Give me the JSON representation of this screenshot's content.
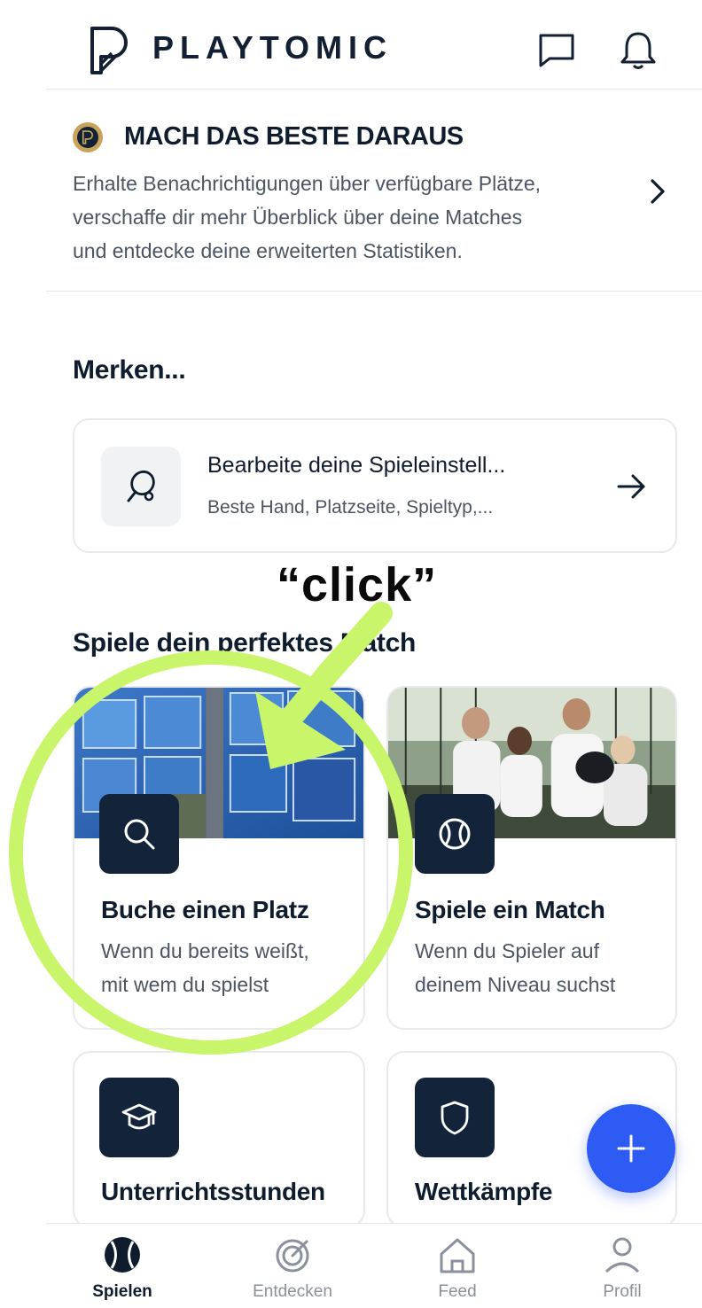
{
  "header": {
    "brand": "PLAYTOMIC"
  },
  "promo": {
    "title": "MACH DAS BESTE DARAUS",
    "lines": [
      "Erhalte Benachrichtigungen über verfügbare Plätze,",
      "verschaffe dir mehr Überblick über deine Matches",
      "und entdecke deine erweiterten Statistiken."
    ]
  },
  "merken": {
    "title": "Merken...",
    "card_title": "Bearbeite deine Spieleinstell...",
    "card_subtitle": "Beste Hand, Platzseite, Spieltyp,..."
  },
  "annotation": {
    "click": "“click”"
  },
  "match": {
    "title": "Spiele dein perfektes Match",
    "cards": [
      {
        "title": "Buche einen Platz",
        "lines": [
          "Wenn du bereits weißt,",
          "mit wem du spielst"
        ],
        "icon": "search-icon"
      },
      {
        "title": "Spiele ein Match",
        "lines": [
          "Wenn du Spieler auf",
          "deinem Niveau suchst"
        ],
        "icon": "ball-icon"
      },
      {
        "title": "Unterrichtsstunden",
        "icon": "graduation-cap-icon"
      },
      {
        "title": "Wettkämpfe",
        "icon": "shield-icon"
      }
    ]
  },
  "bottom_nav": {
    "items": [
      {
        "label": "Spielen",
        "icon": "ball-icon",
        "active": true
      },
      {
        "label": "Entdecken",
        "icon": "target-icon",
        "active": false
      },
      {
        "label": "Feed",
        "icon": "home-icon",
        "active": false
      },
      {
        "label": "Profil",
        "icon": "user-icon",
        "active": false
      }
    ]
  },
  "colors": {
    "accent": "#2f5bf5",
    "dark": "#12233a",
    "highlight": "#c8f56a",
    "gold": "#c8a45a"
  }
}
